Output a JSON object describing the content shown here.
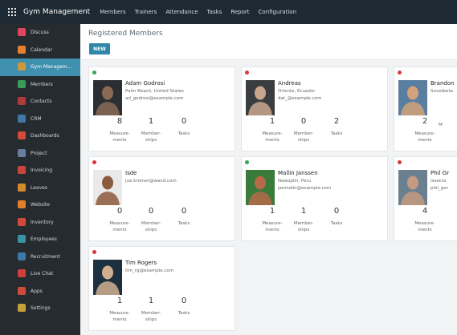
{
  "topbar": {
    "app_title": "Gym Management",
    "menu": [
      "Members",
      "Trainers",
      "Attendance",
      "Tasks",
      "Report",
      "Configuration"
    ]
  },
  "sidebar": {
    "items": [
      {
        "label": "Discuss",
        "icon": "chat-icon",
        "color": "#e0465c"
      },
      {
        "label": "Calendar",
        "icon": "calendar-icon",
        "color": "#e57e2c"
      },
      {
        "label": "Gym Managem...",
        "icon": "gym-icon",
        "color": "#cc9a3a",
        "active": true
      },
      {
        "label": "Members",
        "icon": "person-icon",
        "color": "#3a9a5a"
      },
      {
        "label": "Contacts",
        "icon": "contacts-icon",
        "color": "#b03a3a"
      },
      {
        "label": "CRM",
        "icon": "crm-icon",
        "color": "#3f77a6"
      },
      {
        "label": "Dashboards",
        "icon": "dashboard-icon",
        "color": "#d24b3a"
      },
      {
        "label": "Project",
        "icon": "project-icon",
        "color": "#6a7fa0"
      },
      {
        "label": "Invoicing",
        "icon": "invoice-icon",
        "color": "#c8463a"
      },
      {
        "label": "Leaves",
        "icon": "leaves-icon",
        "color": "#d28a2a"
      },
      {
        "label": "Website",
        "icon": "website-icon",
        "color": "#e07f2c"
      },
      {
        "label": "Inventory",
        "icon": "inventory-icon",
        "color": "#d24b3a"
      },
      {
        "label": "Employees",
        "icon": "employees-icon",
        "color": "#3a93a3"
      },
      {
        "label": "Recruitment",
        "icon": "recruitment-icon",
        "color": "#3f77a6"
      },
      {
        "label": "Live Chat",
        "icon": "livechat-icon",
        "color": "#d0403a"
      },
      {
        "label": "Apps",
        "icon": "apps-icon",
        "color": "#d04a3a"
      },
      {
        "label": "Settings",
        "icon": "gear-icon",
        "color": "#c6a13a"
      }
    ]
  },
  "main": {
    "breadcrumb": "Registered Members",
    "new_label": "NEW"
  },
  "members": [
    {
      "name": "Adam Godrosi",
      "location": "Palm Beach, United States",
      "email": "ad_godrosi@example.com",
      "status": "green",
      "measurements": "8",
      "memberships": "1",
      "tasks": "0"
    },
    {
      "name": "Andreas",
      "location": "Oriente, Ecuador",
      "email": "dat_@example.com",
      "status": "red",
      "measurements": "1",
      "memberships": "0",
      "tasks": "2"
    },
    {
      "name": "Brandon",
      "location": "Sovetbeta",
      "email": "",
      "status": "red",
      "measurements": "2",
      "memberships": "",
      "tasks": ""
    },
    {
      "name": "Isde",
      "location": "",
      "email": "jue.kromer@wand.com",
      "status": "red",
      "measurements": "0",
      "memberships": "0",
      "tasks": "0"
    },
    {
      "name": "Mallin Janssen",
      "location": "Nawoplin, Peru",
      "email": "janmalin@example.com",
      "status": "green",
      "measurements": "1",
      "memberships": "1",
      "tasks": "0"
    },
    {
      "name": "Phil Gr",
      "location": "Issecra",
      "email": "phil_gor",
      "status": "red",
      "measurements": "4",
      "memberships": "",
      "tasks": ""
    },
    {
      "name": "Tim Rogers",
      "location": "",
      "email": "tim_rg@example.com",
      "status": "red",
      "measurements": "1",
      "memberships": "1",
      "tasks": "0"
    }
  ],
  "stat_labels": {
    "measurements": "Measure-\nments",
    "memberships": "Member-\nships",
    "tasks": "Tasks",
    "measurements_cut": "Measure-\nments",
    "memberships_cut": "M"
  },
  "colors": {
    "topbar": "#1d2a33",
    "sidebar": "#252b2f",
    "active": "#3f8fae",
    "new_button": "#2e86a8",
    "status_green": "#2fa84f",
    "status_red": "#d9363e"
  }
}
